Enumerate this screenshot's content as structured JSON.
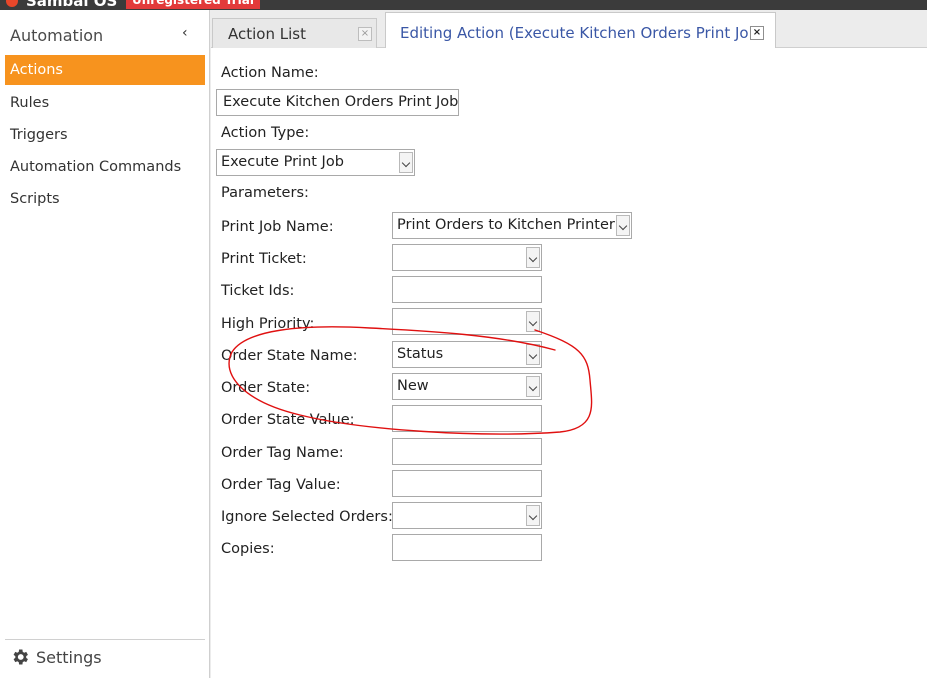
{
  "titlebar": {
    "app_name": "Sambal OS",
    "badge": "Unregistered Trial"
  },
  "sidebar": {
    "title": "Automation",
    "items": [
      {
        "label": "Actions",
        "active": true
      },
      {
        "label": "Rules",
        "active": false
      },
      {
        "label": "Triggers",
        "active": false
      },
      {
        "label": "Automation Commands",
        "active": false
      },
      {
        "label": "Scripts",
        "active": false
      }
    ],
    "settings_label": "Settings"
  },
  "tabs": [
    {
      "label": "Action List",
      "close": "×"
    },
    {
      "label": "Editing Action (Execute Kitchen Orders Print Job)",
      "close": "×"
    }
  ],
  "form": {
    "action_name_label": "Action Name:",
    "action_name_value": "Execute Kitchen Orders Print Job",
    "action_type_label": "Action Type:",
    "action_type_value": "Execute Print Job",
    "parameters_label": "Parameters:",
    "params": [
      {
        "label": "Print Job Name:",
        "type": "select",
        "value": "Print Orders to Kitchen Printer"
      },
      {
        "label": "Print Ticket:",
        "type": "select",
        "value": ""
      },
      {
        "label": "Ticket Ids:",
        "type": "input",
        "value": ""
      },
      {
        "label": "High Priority:",
        "type": "select",
        "value": ""
      },
      {
        "label": "Order State Name:",
        "type": "select",
        "value": "Status"
      },
      {
        "label": "Order State:",
        "type": "select",
        "value": "New"
      },
      {
        "label": "Order State Value:",
        "type": "input",
        "value": ""
      },
      {
        "label": "Order Tag Name:",
        "type": "input",
        "value": ""
      },
      {
        "label": "Order Tag Value:",
        "type": "input",
        "value": ""
      },
      {
        "label": "Ignore Selected Orders:",
        "type": "select",
        "value": ""
      },
      {
        "label": "Copies:",
        "type": "input",
        "value": ""
      }
    ]
  },
  "colors": {
    "accent": "#f7931e",
    "tab_active_text": "#3a57a6",
    "annotation": "#e01010"
  },
  "icons": {
    "collapse": "chevron-left-icon",
    "settings": "gear-icon",
    "dropdown": "chevron-down-icon"
  }
}
